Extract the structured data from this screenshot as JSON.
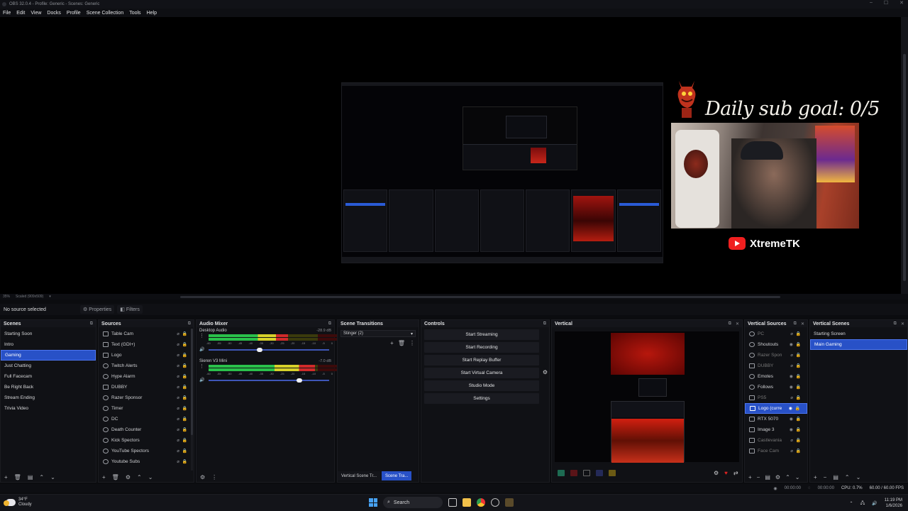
{
  "window": {
    "title": "OBS 32.0.4 - Profile: Generic - Scenes: Generic"
  },
  "menu": [
    "File",
    "Edit",
    "View",
    "Docks",
    "Profile",
    "Scene Collection",
    "Tools",
    "Help"
  ],
  "preview": {
    "goal_text": "Daily sub goal: 0/5",
    "channel_name": "XtremeTK",
    "zoom": "35%",
    "scale_label": "Scaled (909x509)"
  },
  "properties_bar": {
    "no_source": "No source selected",
    "properties": "Properties",
    "filters": "Filters"
  },
  "scenes": {
    "title": "Scenes",
    "items": [
      "Starting Soon",
      "Intro",
      "Gaming",
      "Just Chatting",
      "Full Facecam",
      "Be Right Back",
      "Stream Ending",
      "Trivia Video"
    ],
    "selected_index": 2
  },
  "sources": {
    "title": "Sources",
    "items": [
      "Table Cam",
      "Text (GDI+)",
      "Logo",
      "Twitch Alerts",
      "Hype Alarm",
      "DUBBY",
      "Razer Sponsor",
      "Timer",
      "DC",
      "Death Counter",
      "Kick Spectors",
      "YouTube Spectors",
      "Youtube Subs"
    ]
  },
  "audio_mixer": {
    "title": "Audio Mixer",
    "channels": [
      {
        "name": "Desktop Audio",
        "db": "-28.9 dB",
        "level": 0.62,
        "volume": 0.42
      },
      {
        "name": "Sieren V3 Mini",
        "db": "-7.0 dB",
        "level": 0.83,
        "volume": 0.75
      }
    ],
    "ticks": [
      "-60",
      "-55",
      "-50",
      "-45",
      "-40",
      "-35",
      "-30",
      "-25",
      "-20",
      "-15",
      "-10",
      "-5",
      "0"
    ]
  },
  "transitions": {
    "title": "Scene Transitions",
    "selected": "Stinger (2)",
    "tabs": [
      "Vertical Scene Tr...",
      "Scene Tra..."
    ]
  },
  "controls": {
    "title": "Controls",
    "buttons": [
      "Start Streaming",
      "Start Recording",
      "Start Replay Buffer",
      "Start Virtual Camera",
      "Studio Mode",
      "Settings"
    ]
  },
  "vertical": {
    "title": "Vertical"
  },
  "vertical_sources": {
    "title": "Vertical Sources",
    "items": [
      "PC",
      "Shoutouts",
      "Razer Spon",
      "DUBBY",
      "Emotes",
      "Follows",
      "PS5",
      "Logo (curre",
      "RTX 5070",
      "Image 3",
      "Castlevania",
      "Face Cam"
    ],
    "selected_index": 7
  },
  "vertical_scenes": {
    "title": "Vertical Scenes",
    "items": [
      "Starting Screen",
      "Main Gaming"
    ],
    "selected_index": 1
  },
  "status": {
    "rec_time": "00:00:00",
    "stream_time": "00:00:00",
    "cpu": "CPU: 0.7%",
    "fps": "60.00 / 60.00 FPS"
  },
  "taskbar": {
    "temp": "34°F",
    "weather": "Cloudy",
    "search": "Search",
    "time": "11:19 PM",
    "date": "1/6/2026"
  }
}
